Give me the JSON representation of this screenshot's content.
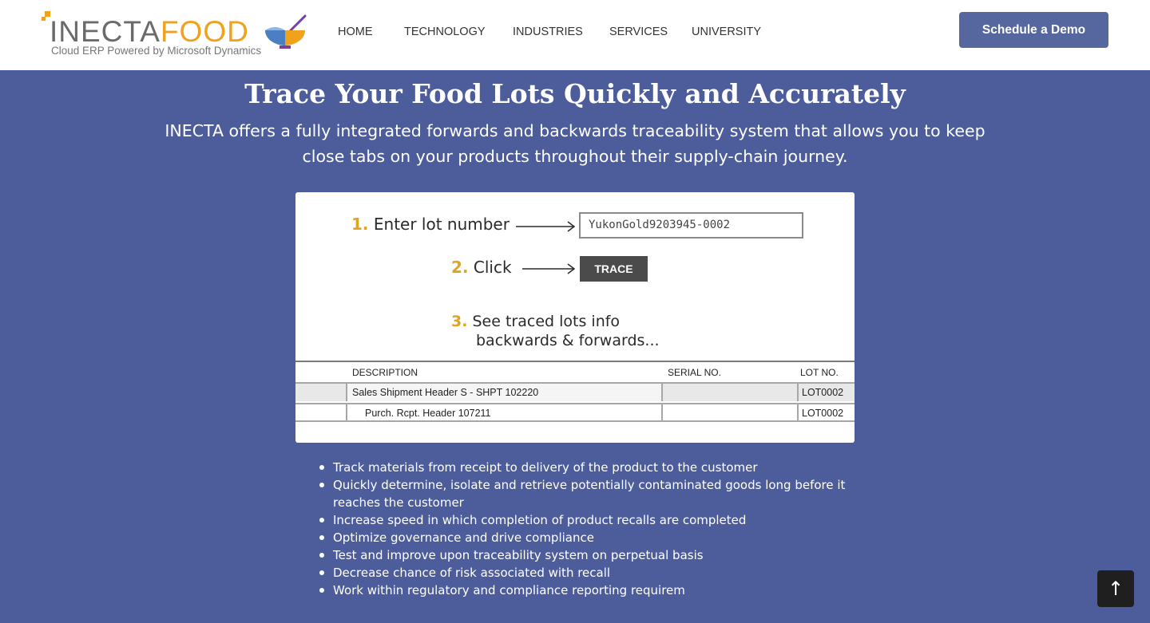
{
  "header": {
    "logo": {
      "word_part1": "INECTA",
      "word_part2": "FOOD",
      "tagline": "Cloud ERP Powered by Microsoft Dynamics"
    },
    "nav": [
      "HOME",
      "TECHNOLOGY",
      "INDUSTRIES",
      "SERVICES",
      "UNIVERSITY"
    ],
    "cta_label": "Schedule a Demo"
  },
  "hero": {
    "title": "Trace Your Food Lots Quickly and Accurately",
    "subtitle": "INECTA offers a fully integrated forwards and backwards traceability system that allows you to keep close tabs on your products throughout their supply-chain journey."
  },
  "illustration": {
    "step1_num": "1.",
    "step1_text": "Enter lot number",
    "lot_value": "YukonGold9203945-0002",
    "step2_num": "2.",
    "step2_text": "Click",
    "trace_label": "TRACE",
    "step3_num": "3.",
    "step3_line1": "See traced lots info",
    "step3_line2": "backwards & forwards...",
    "table": {
      "headers": [
        "DESCRIPTION",
        "SERIAL NO.",
        "LOT NO."
      ],
      "rows": [
        {
          "description": "Sales Shipment Header S - SHPT 102220",
          "serial": "",
          "lot": "LOT0002"
        },
        {
          "description": "Purch. Rcpt. Header 107211",
          "serial": "",
          "lot": "LOT0002"
        }
      ]
    }
  },
  "bullets": [
    "Track materials from receipt to delivery of the product to the customer",
    "Quickly determine, isolate and retrieve potentially contaminated goods long before it reaches the customer",
    "Increase speed in which completion of product recalls are completed",
    "Optimize governance and drive compliance",
    "Test and improve upon traceability system on perpetual basis",
    "Decrease chance of risk associated with recall",
    "Work within regulatory and compliance reporting requirem"
  ],
  "scroll_top_icon": "arrow-up-icon",
  "colors": {
    "background": "#4d5d9c",
    "button": "#56679f",
    "accent": "#f0a21c"
  }
}
